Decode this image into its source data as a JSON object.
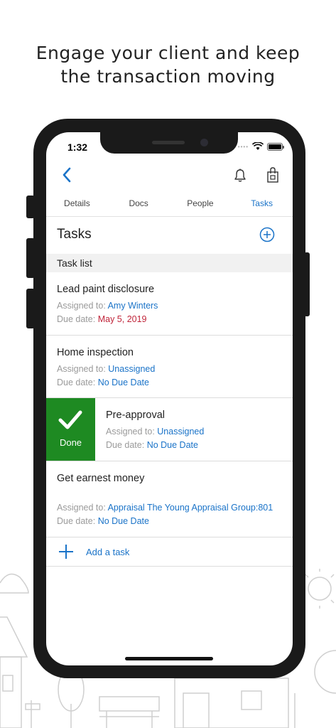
{
  "headline": {
    "line1": "Engage your client and keep",
    "line2": "the transaction moving"
  },
  "status_bar": {
    "time": "1:32",
    "signal_dots": "••••",
    "wifi_icon": "wifi-icon",
    "battery_icon": "battery-icon"
  },
  "nav": {
    "back_icon": "chevron-left-icon",
    "bell_icon": "bell-icon",
    "bag_icon": "shopping-bag-icon"
  },
  "tabs": [
    {
      "label": "Details",
      "active": false
    },
    {
      "label": "Docs",
      "active": false
    },
    {
      "label": "People",
      "active": false
    },
    {
      "label": "Tasks",
      "active": true
    }
  ],
  "section": {
    "title": "Tasks",
    "add_icon": "plus-circle-icon",
    "list_label": "Task list"
  },
  "tasks": [
    {
      "title": "Lead paint disclosure",
      "assigned_label": "Assigned to:",
      "assigned_value": "Amy Winters",
      "due_label": "Due date:",
      "due_value": "May 5, 2019",
      "due_color": "#c0253a"
    },
    {
      "title": "Home inspection",
      "assigned_label": "Assigned to:",
      "assigned_value": "Unassigned",
      "due_label": "Due date:",
      "due_value": "No Due Date"
    },
    {
      "title": "Pre-approval",
      "assigned_label": "Assigned to:",
      "assigned_value": "Unassigned",
      "due_label": "Due date:",
      "due_value": "No Due Date",
      "swipe_action": "Done"
    },
    {
      "title": "Get earnest money",
      "assigned_label": "Assigned to:",
      "assigned_value": "Appraisal The Young Appraisal Group:801",
      "due_label": "Due date:",
      "due_value": "No Due Date"
    }
  ],
  "add_task": {
    "label": "Add a task",
    "icon": "plus-icon"
  },
  "colors": {
    "accent": "#1a73c8",
    "done_green": "#1e8a22",
    "overdue_red": "#c0253a",
    "phone_frame": "#1a1a1a"
  }
}
